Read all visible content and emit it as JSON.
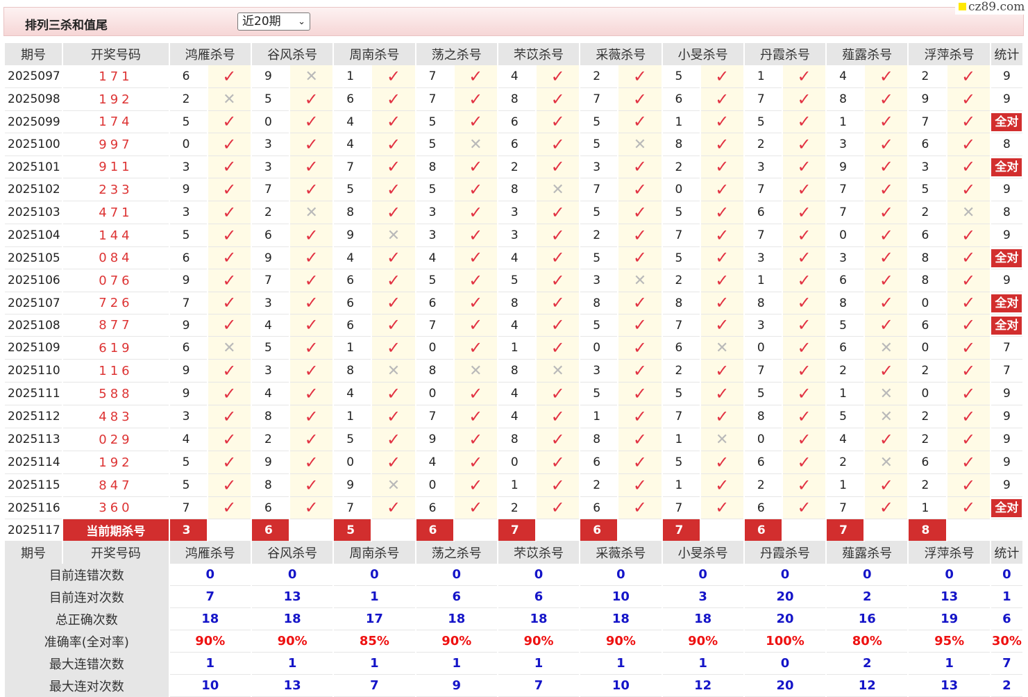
{
  "header": {
    "title": "排列三杀和值尾",
    "period_select": "近20期",
    "watermark": "cz89.com"
  },
  "columns": {
    "period": "期号",
    "draw": "开奖号码",
    "experts": [
      "鸿雁杀号",
      "谷风杀号",
      "周南杀号",
      "荡之杀号",
      "芣苡杀号",
      "采薇杀号",
      "小旻杀号",
      "丹霞杀号",
      "薤露杀号",
      "浮萍杀号"
    ],
    "total": "统计"
  },
  "rows": [
    {
      "period": "2025097",
      "draw": "171",
      "kills": [
        "6",
        "9",
        "1",
        "7",
        "4",
        "2",
        "5",
        "1",
        "4",
        "2"
      ],
      "marks": [
        1,
        0,
        1,
        1,
        1,
        1,
        1,
        1,
        1,
        1
      ],
      "total": "9"
    },
    {
      "period": "2025098",
      "draw": "192",
      "kills": [
        "2",
        "5",
        "6",
        "7",
        "8",
        "7",
        "6",
        "7",
        "8",
        "9"
      ],
      "marks": [
        0,
        1,
        1,
        1,
        1,
        1,
        1,
        1,
        1,
        1
      ],
      "total": "9"
    },
    {
      "period": "2025099",
      "draw": "174",
      "kills": [
        "5",
        "0",
        "4",
        "5",
        "6",
        "5",
        "1",
        "5",
        "1",
        "7"
      ],
      "marks": [
        1,
        1,
        1,
        1,
        1,
        1,
        1,
        1,
        1,
        1
      ],
      "total": "全对"
    },
    {
      "period": "2025100",
      "draw": "997",
      "kills": [
        "0",
        "3",
        "4",
        "5",
        "6",
        "5",
        "8",
        "2",
        "3",
        "6"
      ],
      "marks": [
        1,
        1,
        1,
        0,
        1,
        0,
        1,
        1,
        1,
        1
      ],
      "total": "8"
    },
    {
      "period": "2025101",
      "draw": "911",
      "kills": [
        "3",
        "3",
        "7",
        "8",
        "2",
        "3",
        "2",
        "3",
        "9",
        "3"
      ],
      "marks": [
        1,
        1,
        1,
        1,
        1,
        1,
        1,
        1,
        1,
        1
      ],
      "total": "全对"
    },
    {
      "period": "2025102",
      "draw": "233",
      "kills": [
        "9",
        "7",
        "5",
        "5",
        "8",
        "7",
        "0",
        "7",
        "7",
        "5"
      ],
      "marks": [
        1,
        1,
        1,
        1,
        0,
        1,
        1,
        1,
        1,
        1
      ],
      "total": "9"
    },
    {
      "period": "2025103",
      "draw": "471",
      "kills": [
        "3",
        "2",
        "8",
        "3",
        "3",
        "5",
        "5",
        "6",
        "7",
        "2"
      ],
      "marks": [
        1,
        0,
        1,
        1,
        1,
        1,
        1,
        1,
        1,
        0
      ],
      "total": "8"
    },
    {
      "period": "2025104",
      "draw": "144",
      "kills": [
        "5",
        "6",
        "9",
        "3",
        "3",
        "2",
        "7",
        "7",
        "0",
        "6"
      ],
      "marks": [
        1,
        1,
        0,
        1,
        1,
        1,
        1,
        1,
        1,
        1
      ],
      "total": "9"
    },
    {
      "period": "2025105",
      "draw": "084",
      "kills": [
        "6",
        "9",
        "4",
        "4",
        "4",
        "5",
        "5",
        "3",
        "3",
        "8"
      ],
      "marks": [
        1,
        1,
        1,
        1,
        1,
        1,
        1,
        1,
        1,
        1
      ],
      "total": "全对"
    },
    {
      "period": "2025106",
      "draw": "076",
      "kills": [
        "9",
        "7",
        "6",
        "5",
        "5",
        "3",
        "2",
        "1",
        "6",
        "8"
      ],
      "marks": [
        1,
        1,
        1,
        1,
        1,
        0,
        1,
        1,
        1,
        1
      ],
      "total": "9"
    },
    {
      "period": "2025107",
      "draw": "726",
      "kills": [
        "7",
        "3",
        "6",
        "6",
        "8",
        "8",
        "8",
        "8",
        "8",
        "0"
      ],
      "marks": [
        1,
        1,
        1,
        1,
        1,
        1,
        1,
        1,
        1,
        1
      ],
      "total": "全对"
    },
    {
      "period": "2025108",
      "draw": "877",
      "kills": [
        "9",
        "4",
        "6",
        "7",
        "4",
        "5",
        "7",
        "3",
        "5",
        "6"
      ],
      "marks": [
        1,
        1,
        1,
        1,
        1,
        1,
        1,
        1,
        1,
        1
      ],
      "total": "全对"
    },
    {
      "period": "2025109",
      "draw": "619",
      "kills": [
        "6",
        "5",
        "1",
        "0",
        "1",
        "0",
        "6",
        "0",
        "6",
        "0"
      ],
      "marks": [
        0,
        1,
        1,
        1,
        1,
        1,
        0,
        1,
        0,
        1
      ],
      "total": "7"
    },
    {
      "period": "2025110",
      "draw": "116",
      "kills": [
        "9",
        "3",
        "8",
        "8",
        "8",
        "3",
        "2",
        "7",
        "2",
        "2"
      ],
      "marks": [
        1,
        1,
        0,
        0,
        0,
        1,
        1,
        1,
        1,
        1
      ],
      "total": "7"
    },
    {
      "period": "2025111",
      "draw": "588",
      "kills": [
        "9",
        "4",
        "4",
        "0",
        "4",
        "5",
        "5",
        "5",
        "1",
        "0"
      ],
      "marks": [
        1,
        1,
        1,
        1,
        1,
        1,
        1,
        1,
        0,
        1
      ],
      "total": "9"
    },
    {
      "period": "2025112",
      "draw": "483",
      "kills": [
        "3",
        "8",
        "1",
        "7",
        "4",
        "1",
        "7",
        "8",
        "5",
        "2"
      ],
      "marks": [
        1,
        1,
        1,
        1,
        1,
        1,
        1,
        1,
        0,
        1
      ],
      "total": "9"
    },
    {
      "period": "2025113",
      "draw": "029",
      "kills": [
        "4",
        "2",
        "5",
        "9",
        "8",
        "8",
        "1",
        "0",
        "4",
        "2"
      ],
      "marks": [
        1,
        1,
        1,
        1,
        1,
        1,
        0,
        1,
        1,
        1
      ],
      "total": "9"
    },
    {
      "period": "2025114",
      "draw": "192",
      "kills": [
        "5",
        "9",
        "0",
        "4",
        "0",
        "6",
        "5",
        "6",
        "2",
        "6"
      ],
      "marks": [
        1,
        1,
        1,
        1,
        1,
        1,
        1,
        1,
        0,
        1
      ],
      "total": "9"
    },
    {
      "period": "2025115",
      "draw": "847",
      "kills": [
        "5",
        "8",
        "9",
        "0",
        "1",
        "2",
        "1",
        "2",
        "1",
        "2"
      ],
      "marks": [
        1,
        1,
        0,
        1,
        1,
        1,
        1,
        1,
        1,
        1
      ],
      "total": "9"
    },
    {
      "period": "2025116",
      "draw": "360",
      "kills": [
        "7",
        "6",
        "7",
        "6",
        "2",
        "6",
        "7",
        "6",
        "7",
        "1"
      ],
      "marks": [
        1,
        1,
        1,
        1,
        1,
        1,
        1,
        1,
        1,
        1
      ],
      "total": "全对"
    }
  ],
  "current": {
    "period": "2025117",
    "label": "当前期杀号",
    "kills": [
      "3",
      "6",
      "5",
      "6",
      "7",
      "6",
      "7",
      "6",
      "7",
      "8"
    ]
  },
  "stats": [
    {
      "label": "目前连错次数",
      "values": [
        "0",
        "0",
        "0",
        "0",
        "0",
        "0",
        "0",
        "0",
        "0",
        "0",
        "0"
      ]
    },
    {
      "label": "目前连对次数",
      "values": [
        "7",
        "13",
        "1",
        "6",
        "6",
        "10",
        "3",
        "20",
        "2",
        "13",
        "1"
      ]
    },
    {
      "label": "总正确次数",
      "values": [
        "18",
        "18",
        "17",
        "18",
        "18",
        "18",
        "18",
        "20",
        "16",
        "19",
        "6"
      ]
    },
    {
      "label": "准确率(全对率)",
      "values": [
        "90%",
        "90%",
        "85%",
        "90%",
        "90%",
        "90%",
        "90%",
        "100%",
        "80%",
        "95%",
        "30%"
      ]
    },
    {
      "label": "最大连错次数",
      "values": [
        "1",
        "1",
        "1",
        "1",
        "1",
        "1",
        "1",
        "0",
        "2",
        "1",
        "7"
      ]
    },
    {
      "label": "最大连对次数",
      "values": [
        "10",
        "13",
        "7",
        "9",
        "7",
        "10",
        "12",
        "20",
        "12",
        "13",
        "2"
      ]
    }
  ],
  "symbols": {
    "correct": "✓",
    "wrong": "✕"
  },
  "icons": {
    "select": "chevron-down-icon",
    "correct": "check-icon",
    "wrong": "cross-icon"
  },
  "colors": {
    "draw_number": "#d33333",
    "badge": "#d22e2e",
    "correct_mark": "#e23243",
    "wrong_mark": "#b9b9b9",
    "stat_value": "#1414c8",
    "stat_percent": "#ee1111",
    "mark_cell_bg": "#fffbe6"
  }
}
